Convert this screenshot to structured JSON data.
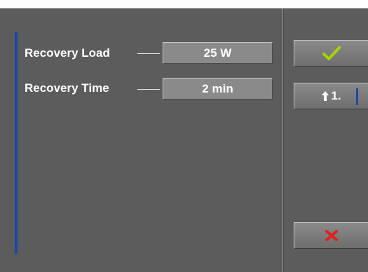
{
  "params": [
    {
      "label": "Recovery Load",
      "value": "25 W"
    },
    {
      "label": "Recovery Time",
      "value": "2 min"
    }
  ],
  "buttons": {
    "confirm_icon": "checkmark-icon",
    "step_icon": "arrow-up-icon",
    "step_label": "1.",
    "cancel_icon": "x-icon"
  },
  "colors": {
    "background": "#5c5c5c",
    "accent": "#1c47a6",
    "confirm": "#a8d400",
    "cancel": "#e02020"
  }
}
